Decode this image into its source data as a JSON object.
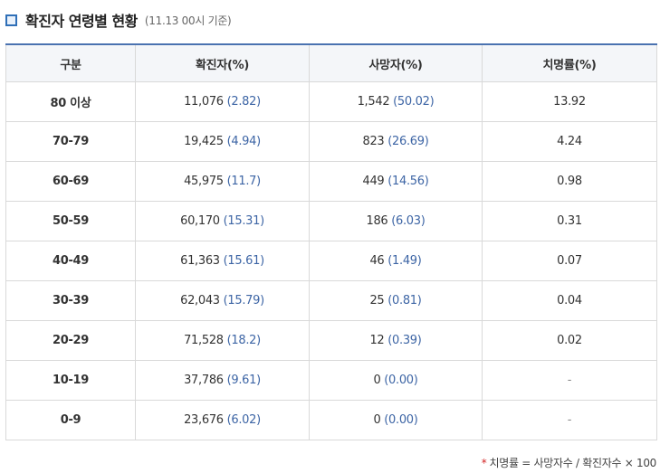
{
  "header": {
    "title": "확진자 연령별 현황",
    "subtitle": "(11.13 00시 기준)"
  },
  "table": {
    "columns": [
      "구분",
      "확진자(%)",
      "사망자(%)",
      "치명률(%)"
    ],
    "rows": [
      {
        "age": "80 이상",
        "confirmed": "11,076",
        "confirmed_pct": "(2.82)",
        "deaths": "1,542",
        "deaths_pct": "(50.02)",
        "fatality": "13.92"
      },
      {
        "age": "70-79",
        "confirmed": "19,425",
        "confirmed_pct": "(4.94)",
        "deaths": "823",
        "deaths_pct": "(26.69)",
        "fatality": "4.24"
      },
      {
        "age": "60-69",
        "confirmed": "45,975",
        "confirmed_pct": "(11.7)",
        "deaths": "449",
        "deaths_pct": "(14.56)",
        "fatality": "0.98"
      },
      {
        "age": "50-59",
        "confirmed": "60,170",
        "confirmed_pct": "(15.31)",
        "deaths": "186",
        "deaths_pct": "(6.03)",
        "fatality": "0.31"
      },
      {
        "age": "40-49",
        "confirmed": "61,363",
        "confirmed_pct": "(15.61)",
        "deaths": "46",
        "deaths_pct": "(1.49)",
        "fatality": "0.07"
      },
      {
        "age": "30-39",
        "confirmed": "62,043",
        "confirmed_pct": "(15.79)",
        "deaths": "25",
        "deaths_pct": "(0.81)",
        "fatality": "0.04"
      },
      {
        "age": "20-29",
        "confirmed": "71,528",
        "confirmed_pct": "(18.2)",
        "deaths": "12",
        "deaths_pct": "(0.39)",
        "fatality": "0.02"
      },
      {
        "age": "10-19",
        "confirmed": "37,786",
        "confirmed_pct": "(9.61)",
        "deaths": "0",
        "deaths_pct": "(0.00)",
        "fatality": "-"
      },
      {
        "age": "0-9",
        "confirmed": "23,676",
        "confirmed_pct": "(6.02)",
        "deaths": "0",
        "deaths_pct": "(0.00)",
        "fatality": "-"
      }
    ]
  },
  "footnote": {
    "marker": "*",
    "text": "치명률 = 사망자수 / 확진자수 × 100"
  },
  "colors": {
    "accent": "#2f6fb7",
    "header_border": "#4a72b0",
    "percent_text": "#3d65a5",
    "footnote_marker": "#d22222"
  }
}
